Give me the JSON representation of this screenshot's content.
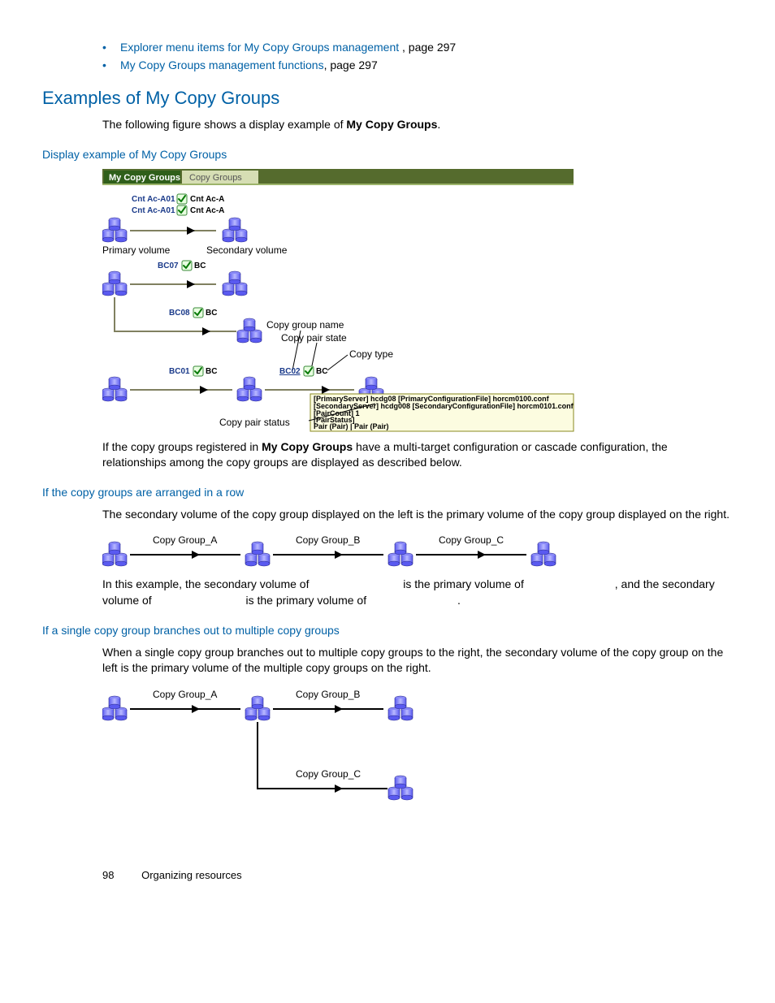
{
  "bullets": [
    {
      "link": "Explorer menu items for My Copy Groups management ",
      "rest": ", page 297"
    },
    {
      "link": "My Copy Groups management functions",
      "rest": ", page 297"
    }
  ],
  "heading_examples": "Examples of My Copy Groups",
  "intro1a": "The following figure shows a display example of ",
  "intro1b": "My Copy Groups",
  "intro1c": ".",
  "sub1": "Display example of My Copy Groups",
  "fig1": {
    "tab_active": "My Copy Groups",
    "tab_inactive": "Copy Groups",
    "r1_left1": "Cnt Ac-A01",
    "r1_right1": "Cnt Ac-A",
    "r1_left2": "Cnt Ac-A01",
    "r1_right2": "Cnt Ac-A",
    "primary": "Primary volume",
    "secondary": "Secondary volume",
    "r2_left": "BC07",
    "r2_right": "BC",
    "r3_left": "BC08",
    "r3_right": "BC",
    "r4_left": "BC01",
    "r4_right": "BC",
    "r4b_left": "BC02",
    "r4b_right": "BC",
    "ann_cgn": "Copy group name",
    "ann_cps": "Copy pair state",
    "ann_ct": "Copy type",
    "ann_status": "Copy pair status",
    "tooltip_l1": "[PrimaryServer] hcdg08 [PrimaryConfigurationFile] horcm0100.conf",
    "tooltip_l2": "[SecondaryServer] hcdg008 [SecondaryConfigurationFile] horcm0101.conf",
    "tooltip_l3": "[PairCount] 1",
    "tooltip_l4": "[PairStatus]",
    "tooltip_l5": "Pair (Pair) | Pair (Pair)"
  },
  "para2a": "If the copy groups registered in ",
  "para2b": "My Copy Groups",
  "para2c": " have a multi-target configuration or cascade configuration, the relationships among the copy groups are displayed as described below.",
  "sub2": "If the copy groups are arranged in a row",
  "para3": "The secondary volume of the copy group displayed on the left is the primary volume of the copy group displayed on the right.",
  "figrow": {
    "a": "Copy Group_A",
    "b": "Copy Group_B",
    "c": "Copy Group_C"
  },
  "para4a": "In this example, the secondary volume of ",
  "para4b": " is the primary volume of ",
  "para4c": ", and the secondary volume of ",
  "para4d": " is the primary volume of ",
  "para4e": ".",
  "sub3": "If a single copy group branches out to multiple copy groups",
  "para5": "When a single copy group branches out to multiple copy groups to the right, the secondary volume of the copy group on the left is the primary volume of the multiple copy groups on the right.",
  "figbranch": {
    "a": "Copy Group_A",
    "b": "Copy Group_B",
    "c": "Copy Group_C"
  },
  "footer_page": "98",
  "footer_title": "Organizing resources"
}
